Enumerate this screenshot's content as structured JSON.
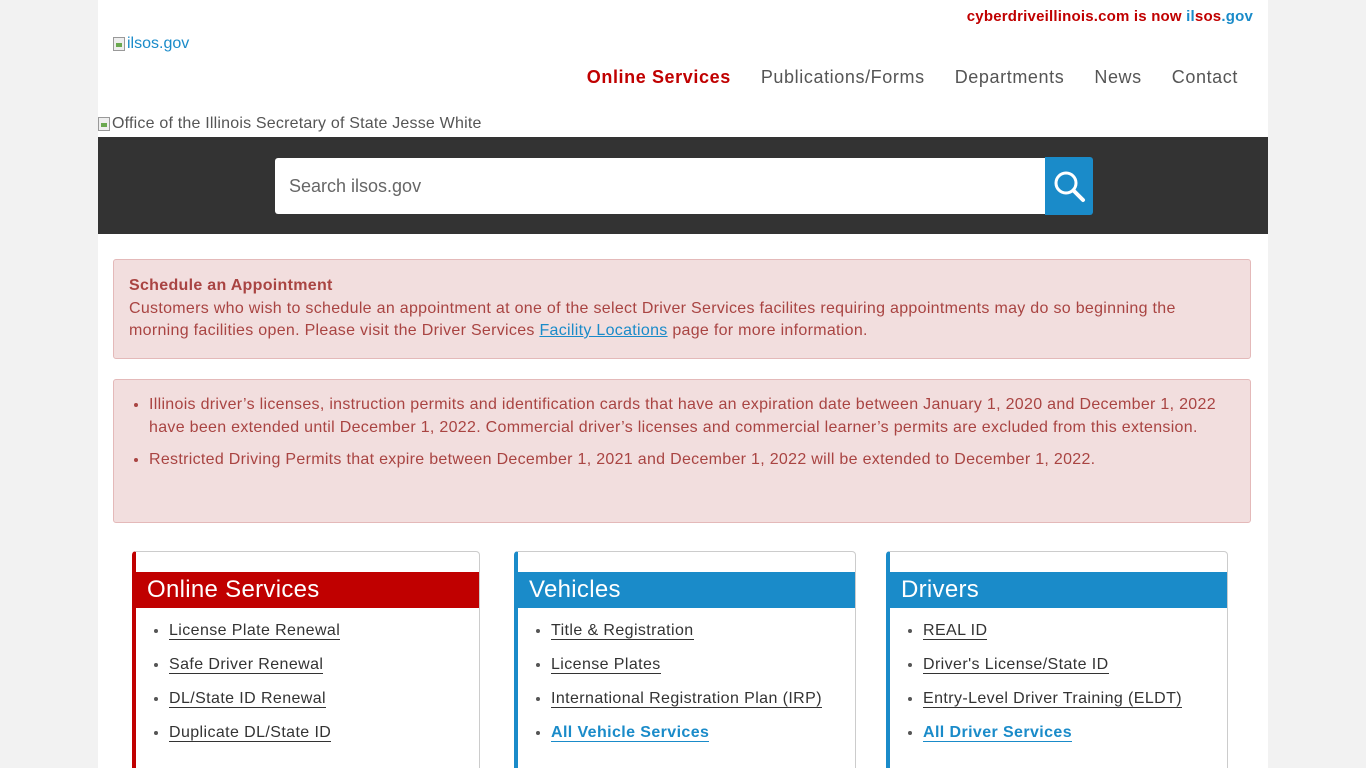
{
  "top_note": {
    "prefix": "cyberdriveillinois.com is now ",
    "il": "il",
    "sos": "sos",
    "gov": ".gov"
  },
  "logo": {
    "alt": "ilsos.gov"
  },
  "nav": [
    {
      "label": "Online Services"
    },
    {
      "label": "Publications/Forms"
    },
    {
      "label": "Departments"
    },
    {
      "label": "News"
    },
    {
      "label": "Contact"
    }
  ],
  "header_image": {
    "alt": "Office of the Illinois Secretary of State Jesse White"
  },
  "search": {
    "placeholder": "Search ilsos.gov",
    "value": ""
  },
  "alert_appointment": {
    "title": "Schedule an Appointment",
    "text_before": "Customers who wish to schedule an appointment at one of the select Driver Services facilites requiring appointments may do so beginning the morning facilities open. Please visit the Driver Services ",
    "link": "Facility Locations",
    "text_after": " page for more information."
  },
  "alert_extensions": {
    "items": [
      "Illinois driver’s licenses, instruction permits and identification cards that have an expiration date between January 1, 2020 and December 1, 2022 have been extended until December 1, 2022. Commercial driver’s licenses and commercial learner’s permits are excluded from this extension.",
      "Restricted Driving Permits that expire between December 1, 2021 and December 1, 2022 will be extended to December 1, 2022."
    ]
  },
  "cards": [
    {
      "title": "Online Services",
      "links": [
        "License Plate Renewal",
        "Safe Driver Renewal",
        "DL/State ID Renewal",
        "Duplicate DL/State ID"
      ]
    },
    {
      "title": "Vehicles",
      "links": [
        "Title & Registration",
        "License Plates",
        "International Registration Plan (IRP)",
        "All Vehicle Services"
      ]
    },
    {
      "title": "Drivers",
      "links": [
        "REAL ID",
        "Driver's License/State ID",
        "Entry-Level Driver Training (ELDT)",
        "All Driver Services"
      ]
    }
  ],
  "colors": {
    "brand_red": "#c00000",
    "brand_blue": "#1a8bc9",
    "alert_bg": "#f2dede",
    "search_band": "#333333"
  },
  "icons": {
    "search": "magnifier-icon",
    "broken_image": "broken-image-icon"
  }
}
